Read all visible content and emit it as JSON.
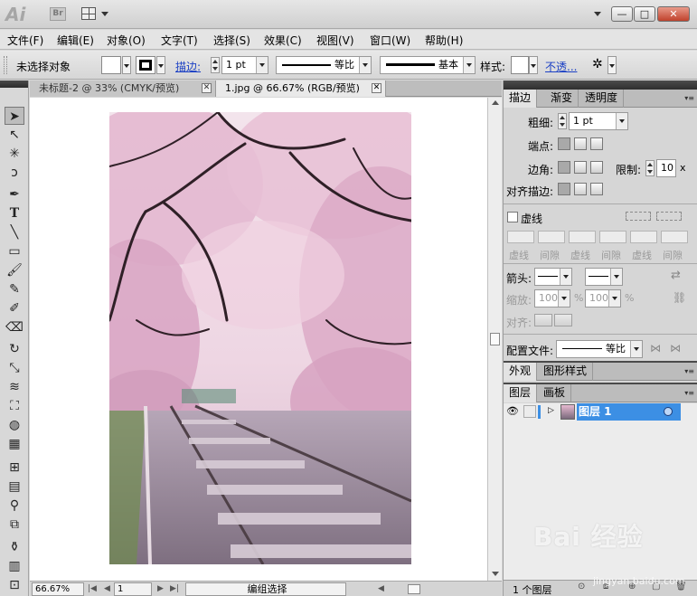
{
  "titlebar": {
    "app_logo": "Ai",
    "bridge_logo": "Br",
    "window_controls": {
      "minimize": "—",
      "maximize": "□",
      "close": "✕"
    }
  },
  "menu": [
    "文件(F)",
    "编辑(E)",
    "对象(O)",
    "文字(T)",
    "选择(S)",
    "效果(C)",
    "视图(V)",
    "窗口(W)",
    "帮助(H)"
  ],
  "control_bar": {
    "selection_status": "未选择对象",
    "stroke_link": "描边:",
    "stroke_weight": "1 pt",
    "profile_label": "等比",
    "brush_label": "基本",
    "style_label": "样式:",
    "opacity_link": "不透..."
  },
  "tabs": [
    {
      "label": "未标题-2 @ 33% (CMYK/预览)",
      "active": false
    },
    {
      "label": "1.jpg @ 66.67% (RGB/预览)",
      "active": true
    }
  ],
  "status": {
    "zoom": "66.67%",
    "artboard": "1",
    "selection_mode": "编组选择"
  },
  "stroke_panel": {
    "tabs": [
      "描边",
      "渐变",
      "透明度"
    ],
    "weight_label": "粗细:",
    "weight_value": "1 pt",
    "cap_label": "端点:",
    "corner_label": "边角:",
    "limit_label": "限制:",
    "limit_value": "10",
    "limit_unit": "x",
    "align_label": "对齐描边:",
    "dashed_label": "虚线",
    "dash_labels": [
      "虚线",
      "间隙",
      "虚线",
      "间隙",
      "虚线",
      "间隙"
    ],
    "arrow_label": "箭头:",
    "scale_label": "缩放:",
    "scale_1": "100",
    "scale_2": "100",
    "percent": "%",
    "align2_label": "对齐:",
    "profile_label": "配置文件:",
    "profile_value": "等比"
  },
  "appearance_panel": {
    "tabs": [
      "外观",
      "图形样式"
    ]
  },
  "layers_panel": {
    "tabs": [
      "图层",
      "画板"
    ],
    "layers": [
      {
        "name": "图层 1",
        "visible": true
      }
    ],
    "count": "1 个图层"
  },
  "watermark": {
    "brand": "Bai 经验",
    "url": "jingyan.baidu.com"
  },
  "colors": {
    "layer_highlight": "#3c8fe4",
    "link_blue": "#1a3fc4",
    "panel_header": "#3a3a3a"
  },
  "photo": {
    "subject": "cherry-blossom-tunnel-railway",
    "palette": [
      "#e8c4d8",
      "#3a2a30",
      "#8d8896",
      "#5e8a4a"
    ]
  }
}
